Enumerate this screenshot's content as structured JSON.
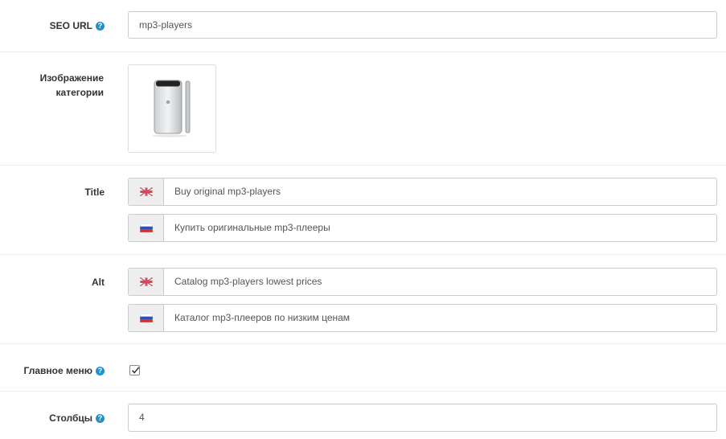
{
  "seo_url": {
    "label": "SEO URL",
    "value": "mp3-players"
  },
  "category_image": {
    "label_line1": "Изображение",
    "label_line2": "категории"
  },
  "title": {
    "label": "Title",
    "en_value": "Buy original mp3-players",
    "ru_value": "Купить оригинальные mp3-плееры"
  },
  "alt": {
    "label": "Alt",
    "en_value": "Catalog mp3-players lowest prices",
    "ru_value": "Каталог mp3-плееров по низким ценам"
  },
  "main_menu": {
    "label": "Главное меню",
    "checked": true
  },
  "columns": {
    "label": "Столбцы",
    "value": "4"
  },
  "help_glyph": "?",
  "colors": {
    "help": "#1e91cf",
    "addon_bg": "#eeeeee",
    "border": "#cccccc"
  }
}
